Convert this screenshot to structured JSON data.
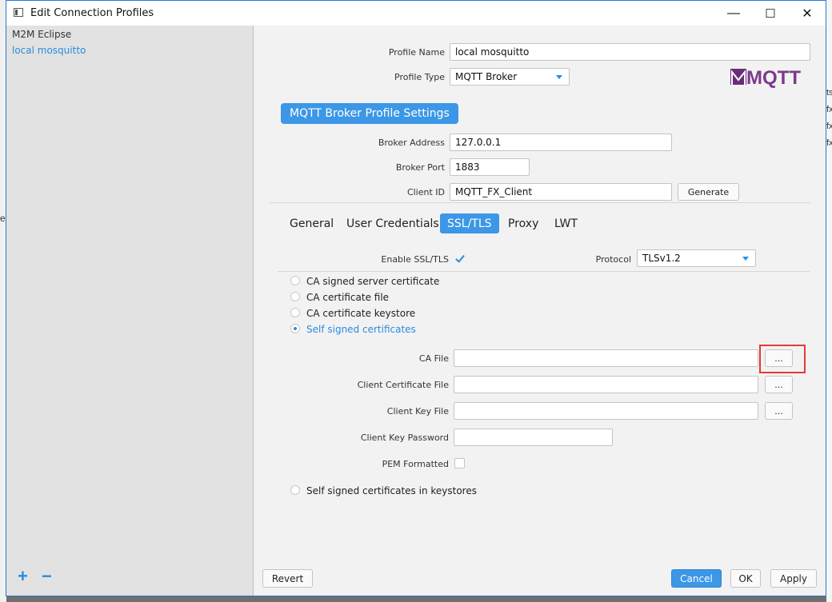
{
  "window": {
    "title": "Edit Connection Profiles",
    "controls": {
      "minimize": "—",
      "maximize": "☐",
      "close": "✕"
    }
  },
  "sidebar": {
    "profiles": [
      {
        "label": "M2M Eclipse",
        "selected": false
      },
      {
        "label": "local mosquitto",
        "selected": true
      }
    ],
    "add_label": "+",
    "remove_label": "−"
  },
  "profile": {
    "name_label": "Profile Name",
    "name_value": "local mosquitto",
    "type_label": "Profile Type",
    "type_value": "MQTT Broker",
    "logo_text": "MQTT"
  },
  "broker": {
    "section_title": "MQTT Broker Profile Settings",
    "address_label": "Broker Address",
    "address_value": "127.0.0.1",
    "port_label": "Broker Port",
    "port_value": "1883",
    "client_id_label": "Client ID",
    "client_id_value": "MQTT_FX_Client",
    "generate_label": "Generate"
  },
  "tabs": [
    {
      "label": "General",
      "active": false
    },
    {
      "label": "User Credentials",
      "active": false
    },
    {
      "label": "SSL/TLS",
      "active": true
    },
    {
      "label": "Proxy",
      "active": false
    },
    {
      "label": "LWT",
      "active": false
    }
  ],
  "ssl": {
    "enable_label": "Enable SSL/TLS",
    "enabled": true,
    "protocol_label": "Protocol",
    "protocol_value": "TLSv1.2",
    "options": [
      {
        "label": "CA signed server certificate",
        "selected": false
      },
      {
        "label": "CA certificate file",
        "selected": false
      },
      {
        "label": "CA certificate keystore",
        "selected": false
      },
      {
        "label": "Self signed certificates",
        "selected": true
      }
    ],
    "ca_file_label": "CA File",
    "ca_file_value": "",
    "client_cert_label": "Client Certificate File",
    "client_cert_value": "",
    "client_key_label": "Client Key File",
    "client_key_value": "",
    "client_key_password_label": "Client Key Password",
    "client_key_password_value": "",
    "pem_label": "PEM Formatted",
    "pem_checked": false,
    "browse_label": "...",
    "keystore_option_label": "Self signed certificates in keystores",
    "keystore_option_selected": false
  },
  "footer": {
    "revert_label": "Revert",
    "cancel_label": "Cancel",
    "ok_label": "OK",
    "apply_label": "Apply"
  },
  "background_app": {
    "fragments": [
      "ts",
      "fx",
      "fx",
      "fx"
    ],
    "left_fragment": "e"
  },
  "colors": {
    "accent": "#3c97e6",
    "highlight_box": "#e53935",
    "logo_purple": "#6b2c7a"
  }
}
